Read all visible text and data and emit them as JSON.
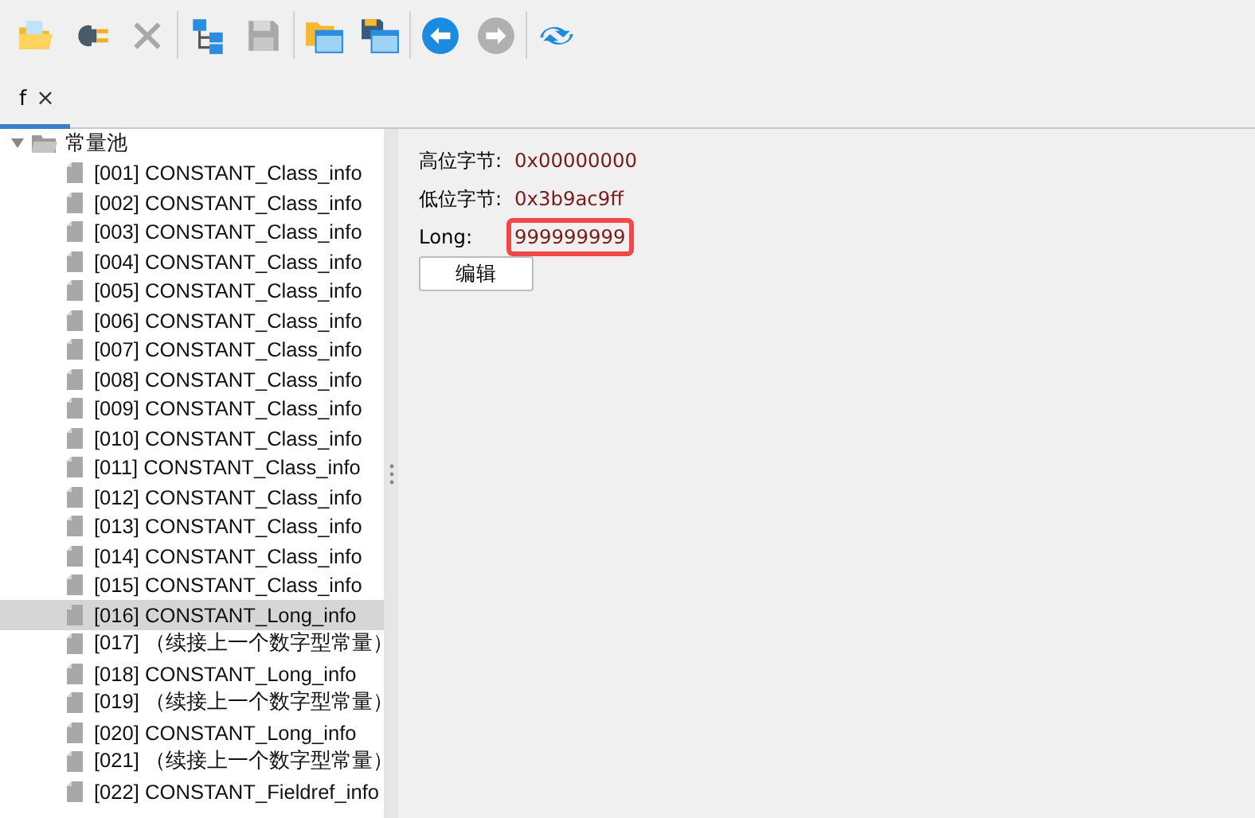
{
  "toolbar": [
    [
      {
        "kind": "open-folder",
        "disabled": false
      },
      {
        "kind": "plug",
        "disabled": false
      },
      {
        "kind": "cross",
        "disabled": true
      }
    ],
    [
      {
        "kind": "hierarchy",
        "disabled": false
      },
      {
        "kind": "floppy",
        "disabled": true
      }
    ],
    [
      {
        "kind": "folder-window",
        "disabled": false
      },
      {
        "kind": "floppy-window",
        "disabled": false
      }
    ],
    [
      {
        "kind": "back",
        "disabled": false
      },
      {
        "kind": "forward",
        "disabled": true
      }
    ],
    [
      {
        "kind": "refresh",
        "disabled": false
      }
    ]
  ],
  "tabs": [
    {
      "label": "f",
      "close": "×",
      "selected": true
    }
  ],
  "tree": {
    "label": "常量池",
    "expanded": true,
    "children": [
      {
        "label": "[001] CONSTANT_Class_info",
        "selected": false
      },
      {
        "label": "[002] CONSTANT_Class_info",
        "selected": false
      },
      {
        "label": "[003] CONSTANT_Class_info",
        "selected": false
      },
      {
        "label": "[004] CONSTANT_Class_info",
        "selected": false
      },
      {
        "label": "[005] CONSTANT_Class_info",
        "selected": false
      },
      {
        "label": "[006] CONSTANT_Class_info",
        "selected": false
      },
      {
        "label": "[007] CONSTANT_Class_info",
        "selected": false
      },
      {
        "label": "[008] CONSTANT_Class_info",
        "selected": false
      },
      {
        "label": "[009] CONSTANT_Class_info",
        "selected": false
      },
      {
        "label": "[010] CONSTANT_Class_info",
        "selected": false
      },
      {
        "label": "[011] CONSTANT_Class_info",
        "selected": false
      },
      {
        "label": "[012] CONSTANT_Class_info",
        "selected": false
      },
      {
        "label": "[013] CONSTANT_Class_info",
        "selected": false
      },
      {
        "label": "[014] CONSTANT_Class_info",
        "selected": false
      },
      {
        "label": "[015] CONSTANT_Class_info",
        "selected": false
      },
      {
        "label": "[016] CONSTANT_Long_info",
        "selected": true
      },
      {
        "label": "[017] （续接上一个数字型常量）",
        "selected": false
      },
      {
        "label": "[018] CONSTANT_Long_info",
        "selected": false
      },
      {
        "label": "[019] （续接上一个数字型常量）",
        "selected": false
      },
      {
        "label": "[020] CONSTANT_Long_info",
        "selected": false
      },
      {
        "label": "[021] （续接上一个数字型常量）",
        "selected": false
      },
      {
        "label": "[022] CONSTANT_Fieldref_info",
        "selected": false
      }
    ]
  },
  "details": {
    "fields": [
      {
        "label": "高位字节:",
        "value": "0x00000000",
        "highlighted": false
      },
      {
        "label": "低位字节:",
        "value": "0x3b9ac9ff",
        "highlighted": false
      },
      {
        "label": "Long:",
        "value": "999999999",
        "highlighted": true
      }
    ],
    "button": "编辑"
  }
}
